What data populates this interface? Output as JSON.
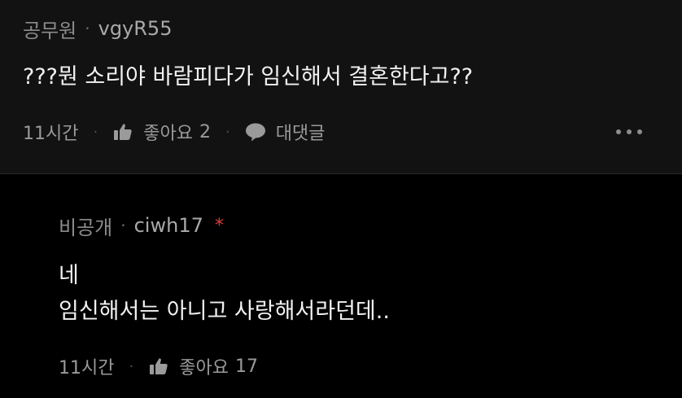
{
  "comments": [
    {
      "category": "공무원",
      "author": "vgyR55",
      "text": "???뭔 소리야 바람피다가 임신해서 결혼한다고??",
      "time": "11시간",
      "like_label": "좋아요",
      "like_count": "2",
      "reply_label": "대댓글",
      "icons": {
        "like": "thumbs-up-icon",
        "reply": "speech-bubble-icon",
        "more": "more-horizontal-icon"
      }
    },
    {
      "category": "비공개",
      "author": "ciwh17",
      "author_marker": "*",
      "text_lines": [
        "네",
        "임신해서는 아니고 사랑해서라던데.."
      ],
      "time": "11시간",
      "like_label": "좋아요",
      "like_count": "17",
      "icons": {
        "like": "thumbs-up-icon"
      }
    }
  ],
  "colors": {
    "top_background": "#121212",
    "reply_background": "#000000",
    "author_marker": "#e03a3a",
    "meta_text": "#8c8c8c"
  }
}
